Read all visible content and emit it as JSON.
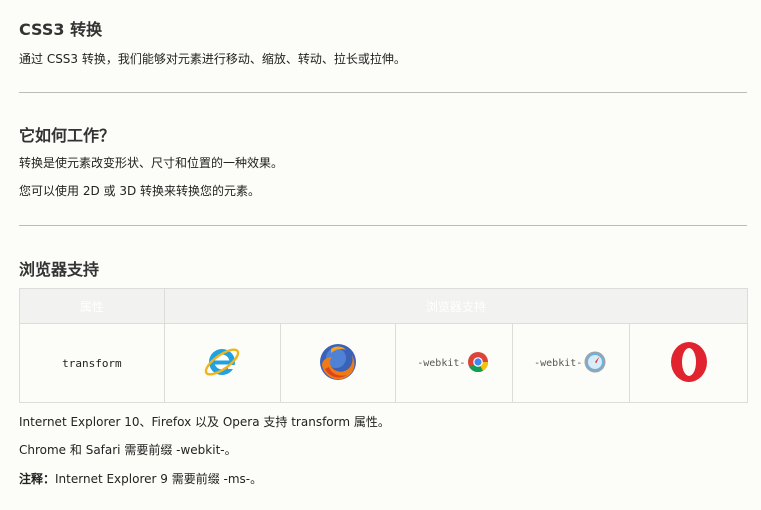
{
  "section1": {
    "title": "CSS3 转换",
    "text": "通过 CSS3 转换，我们能够对元素进行移动、缩放、转动、拉长或拉伸。"
  },
  "section2": {
    "title": "它如何工作？",
    "line1": "转换是使元素改变形状、尺寸和位置的一种效果。",
    "line2": "您可以使用 2D 或 3D 转换来转换您的元素。"
  },
  "section3": {
    "title": "浏览器支持",
    "table": {
      "headers": [
        "属性",
        "浏览器支持"
      ],
      "property": "transform",
      "browsers": [
        {
          "icon": "internet-explorer-icon",
          "prefix_left": "",
          "prefix_right": ""
        },
        {
          "icon": "firefox-icon",
          "prefix_left": "",
          "prefix_right": ""
        },
        {
          "icon": "chrome-icon",
          "prefix_left": "-webkit-",
          "prefix_right": ""
        },
        {
          "icon": "safari-icon",
          "prefix_left": "-webkit-",
          "prefix_right": ""
        },
        {
          "icon": "opera-icon",
          "prefix_left": "",
          "prefix_right": ""
        }
      ]
    },
    "note1": "Internet Explorer 10、Firefox 以及 Opera 支持 transform 属性。",
    "note2": "Chrome 和 Safari 需要前缀 -webkit-。",
    "note3_label": "注释：",
    "note3_text": "Internet Explorer 9 需要前缀 -ms-。"
  }
}
